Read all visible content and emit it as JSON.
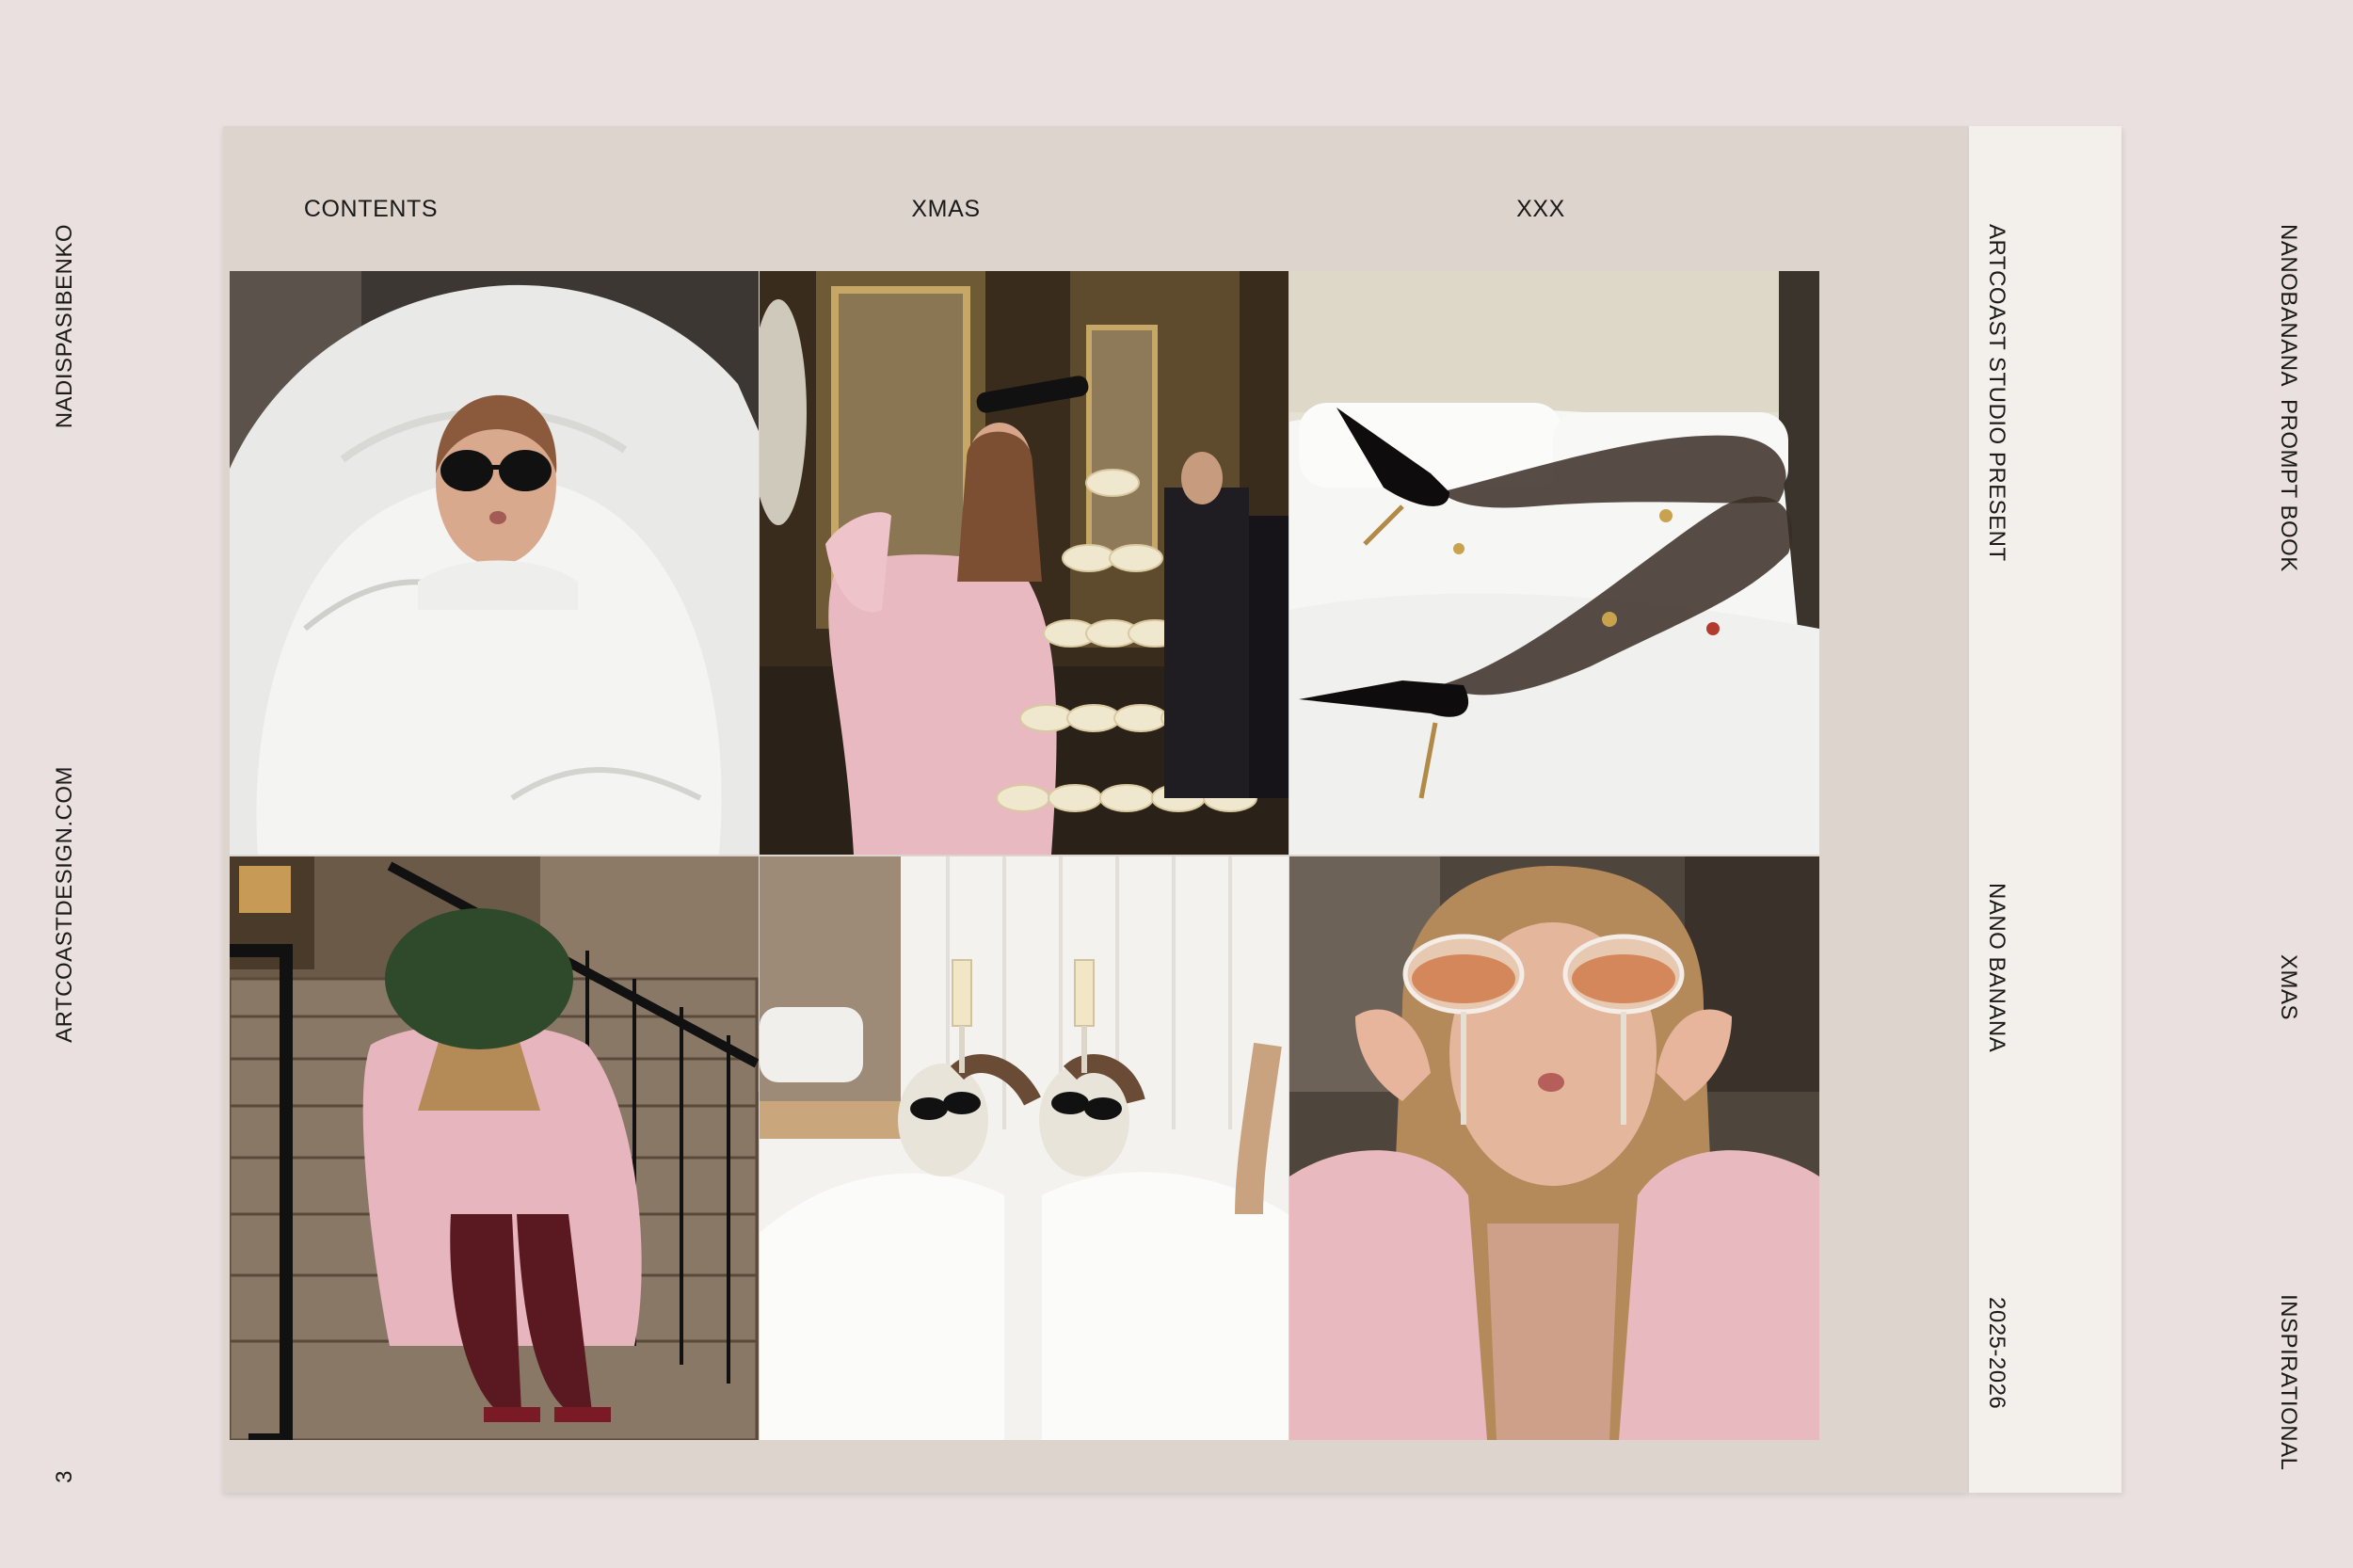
{
  "left_margin": {
    "author": "NADISPASIBENKO",
    "website": "ARTCOASTDESIGN.COM",
    "page_number": "3"
  },
  "header": {
    "nav_items": [
      "CONTENTS",
      "XMAS",
      "XXX"
    ]
  },
  "strip": {
    "presenter": "ARTCOAST STUDIO PRESENT",
    "product": "NANO BANANA",
    "years": "2025-2026"
  },
  "right_margin": {
    "book_title": "NANOBANANA  PROMPT BOOK",
    "section": "XMAS",
    "category": "INSPIRATIONAL"
  },
  "photos": [
    {
      "subject": "woman-in-duvet-sunglasses"
    },
    {
      "subject": "champagne-tower-pink-feathers"
    },
    {
      "subject": "legs-black-heels-on-bed"
    },
    {
      "subject": "woman-pink-fur-christmas-tree-stairs"
    },
    {
      "subject": "couple-face-masks-bathrobes-champagne"
    },
    {
      "subject": "woman-pink-fur-holding-glasses"
    }
  ],
  "colors": {
    "background": "#e9e0df",
    "card": "#ddd4cd",
    "strip": "#f3f0ec",
    "text": "#1b1a19"
  }
}
